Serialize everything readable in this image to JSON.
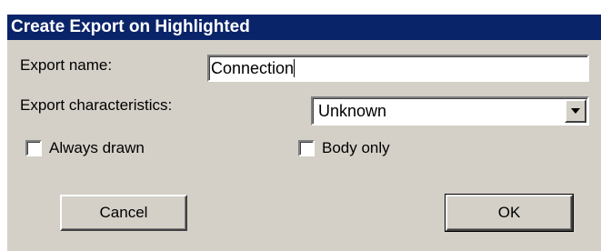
{
  "dialog": {
    "title": "Create Export on Highlighted",
    "export_name_label": "Export name:",
    "export_name_value": "Connection",
    "characteristics_label": "Export characteristics:",
    "characteristics_selected": "Unknown",
    "always_drawn_label": "Always drawn",
    "always_drawn_checked": false,
    "body_only_label": "Body only",
    "body_only_checked": false,
    "cancel_label": "Cancel",
    "ok_label": "OK"
  },
  "colors": {
    "titlebar": "#0a246a",
    "dialog_face": "#d4d0c8"
  },
  "icons": {
    "dropdown": "triangle-down-icon"
  }
}
